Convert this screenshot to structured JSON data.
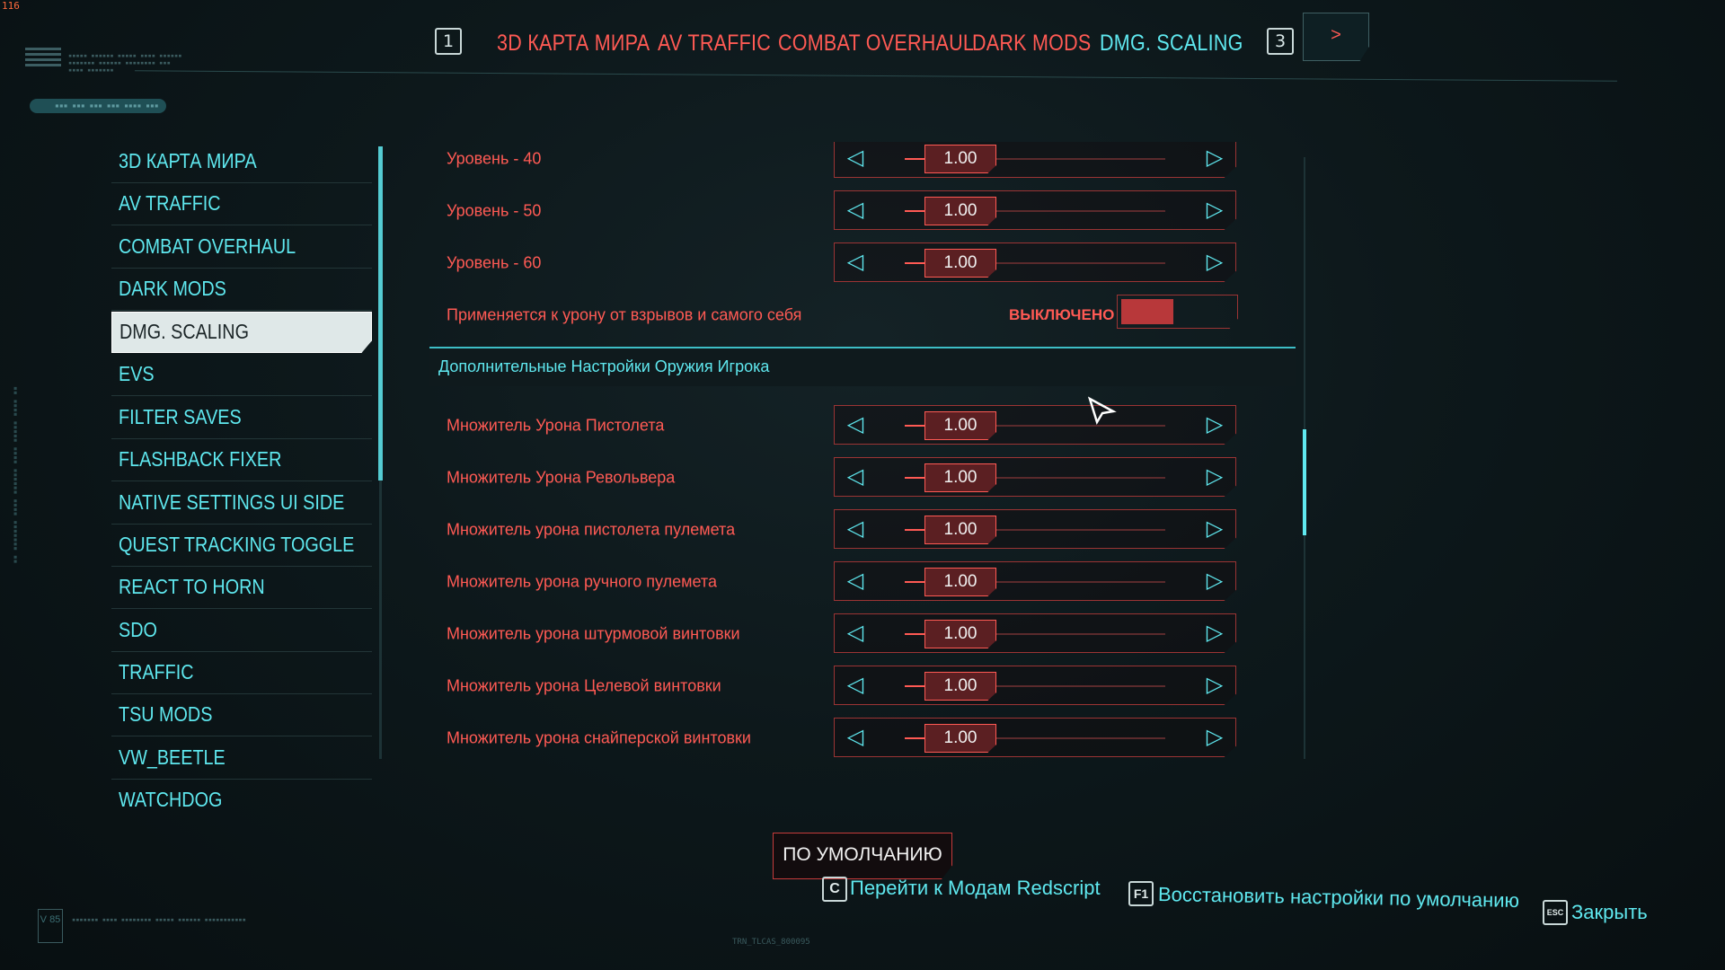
{
  "overlay": {
    "fps": "116",
    "version_label": "V 85",
    "bottom_code": "TRN_TLCAS_800095"
  },
  "topbar": {
    "left_key": "1",
    "right_key": "3",
    "next_label": ">",
    "tabs": [
      {
        "label": "3D КАРТА МИРА",
        "active": false
      },
      {
        "label": "AV TRAFFIC",
        "active": false
      },
      {
        "label": "COMBAT OVERHAUL",
        "active": false
      },
      {
        "label": "DARK MODS",
        "active": false
      },
      {
        "label": "DMG. SCALING",
        "active": true
      }
    ]
  },
  "sidebar": {
    "items": [
      {
        "label": "3D КАРТА МИРА"
      },
      {
        "label": "AV TRAFFIC"
      },
      {
        "label": "COMBAT OVERHAUL"
      },
      {
        "label": "DARK MODS"
      },
      {
        "label": "DMG. SCALING",
        "selected": true
      },
      {
        "label": "EVS"
      },
      {
        "label": "FILTER SAVES"
      },
      {
        "label": "FLASHBACK FIXER"
      },
      {
        "label": "NATIVE SETTINGS UI SIDE"
      },
      {
        "label": "QUEST TRACKING TOGGLE"
      },
      {
        "label": "REACT TO HORN"
      },
      {
        "label": "SDO"
      },
      {
        "label": "TRAFFIC"
      },
      {
        "label": "TSU MODS"
      },
      {
        "label": "VW_BEETLE"
      },
      {
        "label": "WATCHDOG"
      }
    ]
  },
  "settings": {
    "level_rows": [
      {
        "label": "Уровень - 40",
        "value": "1.00",
        "fraction": 0.18
      },
      {
        "label": "Уровень - 50",
        "value": "1.00",
        "fraction": 0.18
      },
      {
        "label": "Уровень - 60",
        "value": "1.00",
        "fraction": 0.18
      }
    ],
    "toggle_row": {
      "label": "Применяется к урону от взрывов и самого себя",
      "state": "ВЫКЛЮЧЕНО"
    },
    "section_title": "Дополнительные Настройки Оружия Игрока",
    "weapon_rows": [
      {
        "label": "Множитель Урона Пистолета",
        "value": "1.00",
        "fraction": 0.18
      },
      {
        "label": "Множитель Урона Револьвера",
        "value": "1.00",
        "fraction": 0.18
      },
      {
        "label": "Множитель урона пистолета пулемета",
        "value": "1.00",
        "fraction": 0.18
      },
      {
        "label": "Множитель урона ручного пулемета",
        "value": "1.00",
        "fraction": 0.18
      },
      {
        "label": "Множитель урона штурмовой винтовки",
        "value": "1.00",
        "fraction": 0.18
      },
      {
        "label": "Множитель урона Целевой винтовки",
        "value": "1.00",
        "fraction": 0.18
      },
      {
        "label": "Множитель урона снайперской винтовки",
        "value": "1.00",
        "fraction": 0.18
      }
    ]
  },
  "bottom": {
    "default_button": "ПО УМОЛЧАНИЮ",
    "hints": [
      {
        "key": "C",
        "label": "Перейти к Модам Redscript"
      },
      {
        "key": "F1",
        "label": "Восстановить настройки по умолчанию"
      },
      {
        "key": "ESC",
        "label": "Закрыть"
      }
    ]
  },
  "colors": {
    "accent_cyan": "#5fe8ef",
    "accent_red": "#ff5a54",
    "background": "#0d181b"
  }
}
